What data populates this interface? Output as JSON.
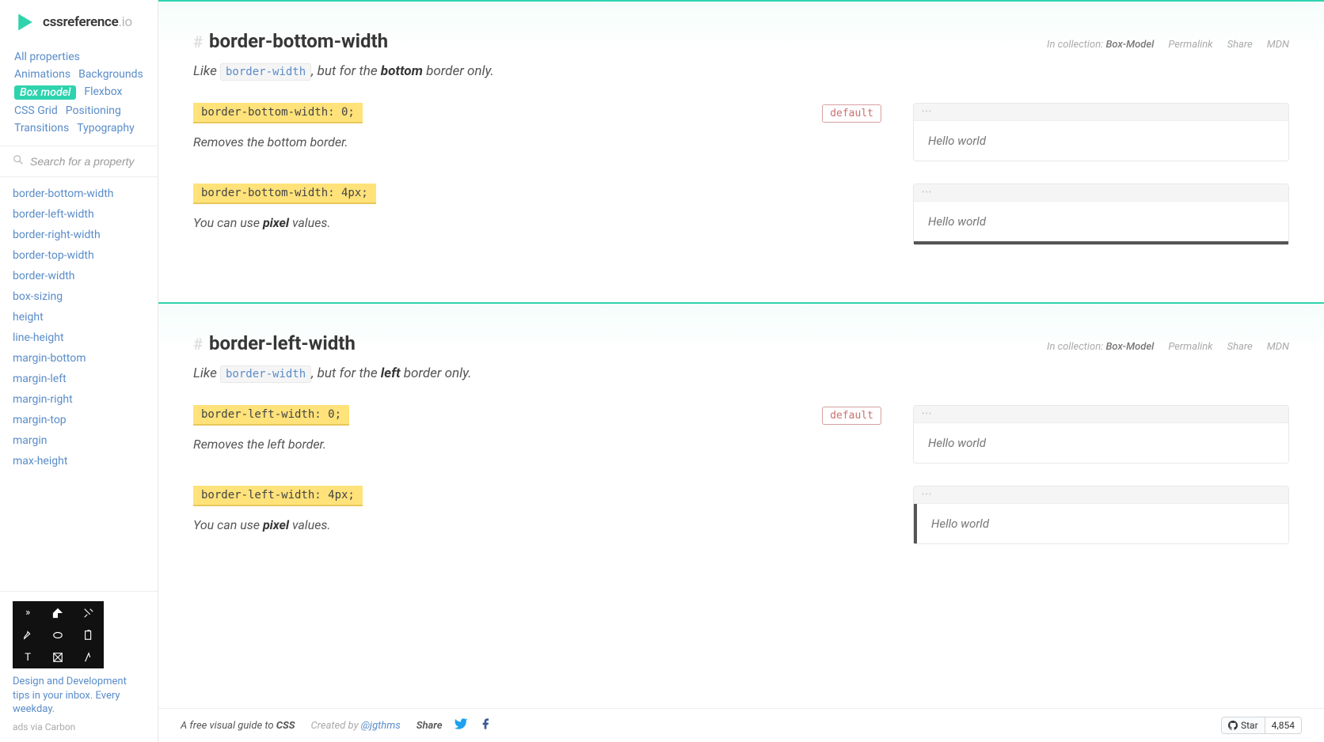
{
  "logo": {
    "name": "cssreference",
    "suffix": ".io"
  },
  "nav_categories": [
    {
      "label": "All properties",
      "active": false
    },
    {
      "label": "Animations",
      "active": false
    },
    {
      "label": "Backgrounds",
      "active": false
    },
    {
      "label": "Box model",
      "active": true
    },
    {
      "label": "Flexbox",
      "active": false
    },
    {
      "label": "CSS Grid",
      "active": false
    },
    {
      "label": "Positioning",
      "active": false
    },
    {
      "label": "Transitions",
      "active": false
    },
    {
      "label": "Typography",
      "active": false
    }
  ],
  "search": {
    "placeholder": "Search for a property"
  },
  "properties": [
    "border-bottom-width",
    "border-left-width",
    "border-right-width",
    "border-top-width",
    "border-width",
    "box-sizing",
    "height",
    "line-height",
    "margin-bottom",
    "margin-left",
    "margin-right",
    "margin-top",
    "margin",
    "max-height"
  ],
  "carbon": {
    "text": "Design and Development tips in your inbox. Every weekday.",
    "via": "ads via Carbon"
  },
  "sections": [
    {
      "title": "border-bottom-width",
      "meta": {
        "collection_label": "In collection:",
        "collection": "Box-Model",
        "permalink": "Permalink",
        "share": "Share",
        "mdn": "MDN"
      },
      "desc_pre": "Like ",
      "desc_code": "border-width",
      "desc_mid": ", but for the ",
      "desc_bold": "bottom",
      "desc_post": " border only.",
      "examples": [
        {
          "code": "border-bottom-width: 0;",
          "default": true,
          "default_label": "default",
          "text_pre": "Removes the bottom border.",
          "text_bold": "",
          "text_post": "",
          "preview": "Hello world",
          "border_class": ""
        },
        {
          "code": "border-bottom-width: 4px;",
          "default": false,
          "text_pre": "You can use ",
          "text_bold": "pixel",
          "text_post": " values.",
          "preview": "Hello world",
          "border_class": "bb4"
        }
      ]
    },
    {
      "title": "border-left-width",
      "meta": {
        "collection_label": "In collection:",
        "collection": "Box-Model",
        "permalink": "Permalink",
        "share": "Share",
        "mdn": "MDN"
      },
      "desc_pre": "Like ",
      "desc_code": "border-width",
      "desc_mid": ", but for the ",
      "desc_bold": "left",
      "desc_post": " border only.",
      "examples": [
        {
          "code": "border-left-width: 0;",
          "default": true,
          "default_label": "default",
          "text_pre": "Removes the left border.",
          "text_bold": "",
          "text_post": "",
          "preview": "Hello world",
          "border_class": ""
        },
        {
          "code": "border-left-width: 4px;",
          "default": false,
          "text_pre": "You can use ",
          "text_bold": "pixel",
          "text_post": " values.",
          "preview": "Hello world",
          "border_class": "bl4"
        }
      ]
    }
  ],
  "footer": {
    "tagline_pre": "A free visual guide to ",
    "tagline_bold": "CSS",
    "created_pre": "Created by ",
    "created_by": "@jgthms",
    "share_label": "Share",
    "github": {
      "star": "Star",
      "count": "4,854"
    }
  }
}
